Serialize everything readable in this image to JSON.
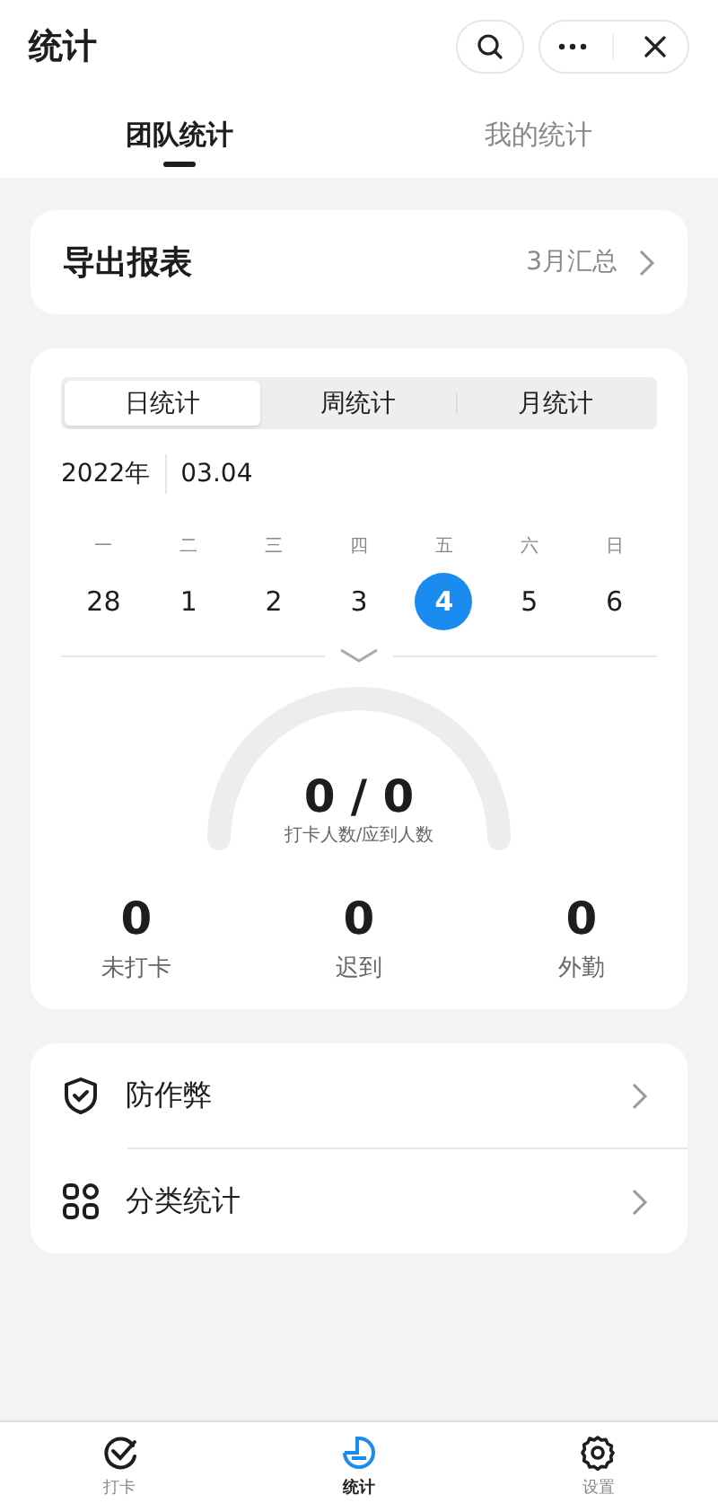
{
  "header": {
    "title": "统计"
  },
  "tabs": [
    {
      "label": "团队统计",
      "selected": true
    },
    {
      "label": "我的统计",
      "selected": false
    }
  ],
  "export": {
    "title": "导出报表",
    "summary": "3月汇总"
  },
  "period_tabs": [
    {
      "label": "日统计",
      "selected": true
    },
    {
      "label": "周统计",
      "selected": false
    },
    {
      "label": "月统计",
      "selected": false
    }
  ],
  "date": {
    "year": "2022年",
    "day": "03.04"
  },
  "weekdays": [
    "一",
    "二",
    "三",
    "四",
    "五",
    "六",
    "日"
  ],
  "days": [
    {
      "label": "28",
      "selected": false
    },
    {
      "label": "1",
      "selected": false
    },
    {
      "label": "2",
      "selected": false
    },
    {
      "label": "3",
      "selected": false
    },
    {
      "label": "4",
      "selected": true
    },
    {
      "label": "5",
      "selected": false
    },
    {
      "label": "6",
      "selected": false
    }
  ],
  "gauge": {
    "value": "0 / 0",
    "caption": "打卡人数/应到人数"
  },
  "stats": [
    {
      "value": "0",
      "label": "未打卡"
    },
    {
      "value": "0",
      "label": "迟到"
    },
    {
      "value": "0",
      "label": "外勤"
    }
  ],
  "menu": [
    {
      "kind": "shield",
      "label": "防作弊"
    },
    {
      "kind": "grid",
      "label": "分类统计"
    }
  ],
  "bottom_nav": [
    {
      "kind": "check",
      "label": "打卡",
      "selected": false
    },
    {
      "kind": "chart",
      "label": "统计",
      "selected": true
    },
    {
      "kind": "gear",
      "label": "设置",
      "selected": false
    }
  ]
}
